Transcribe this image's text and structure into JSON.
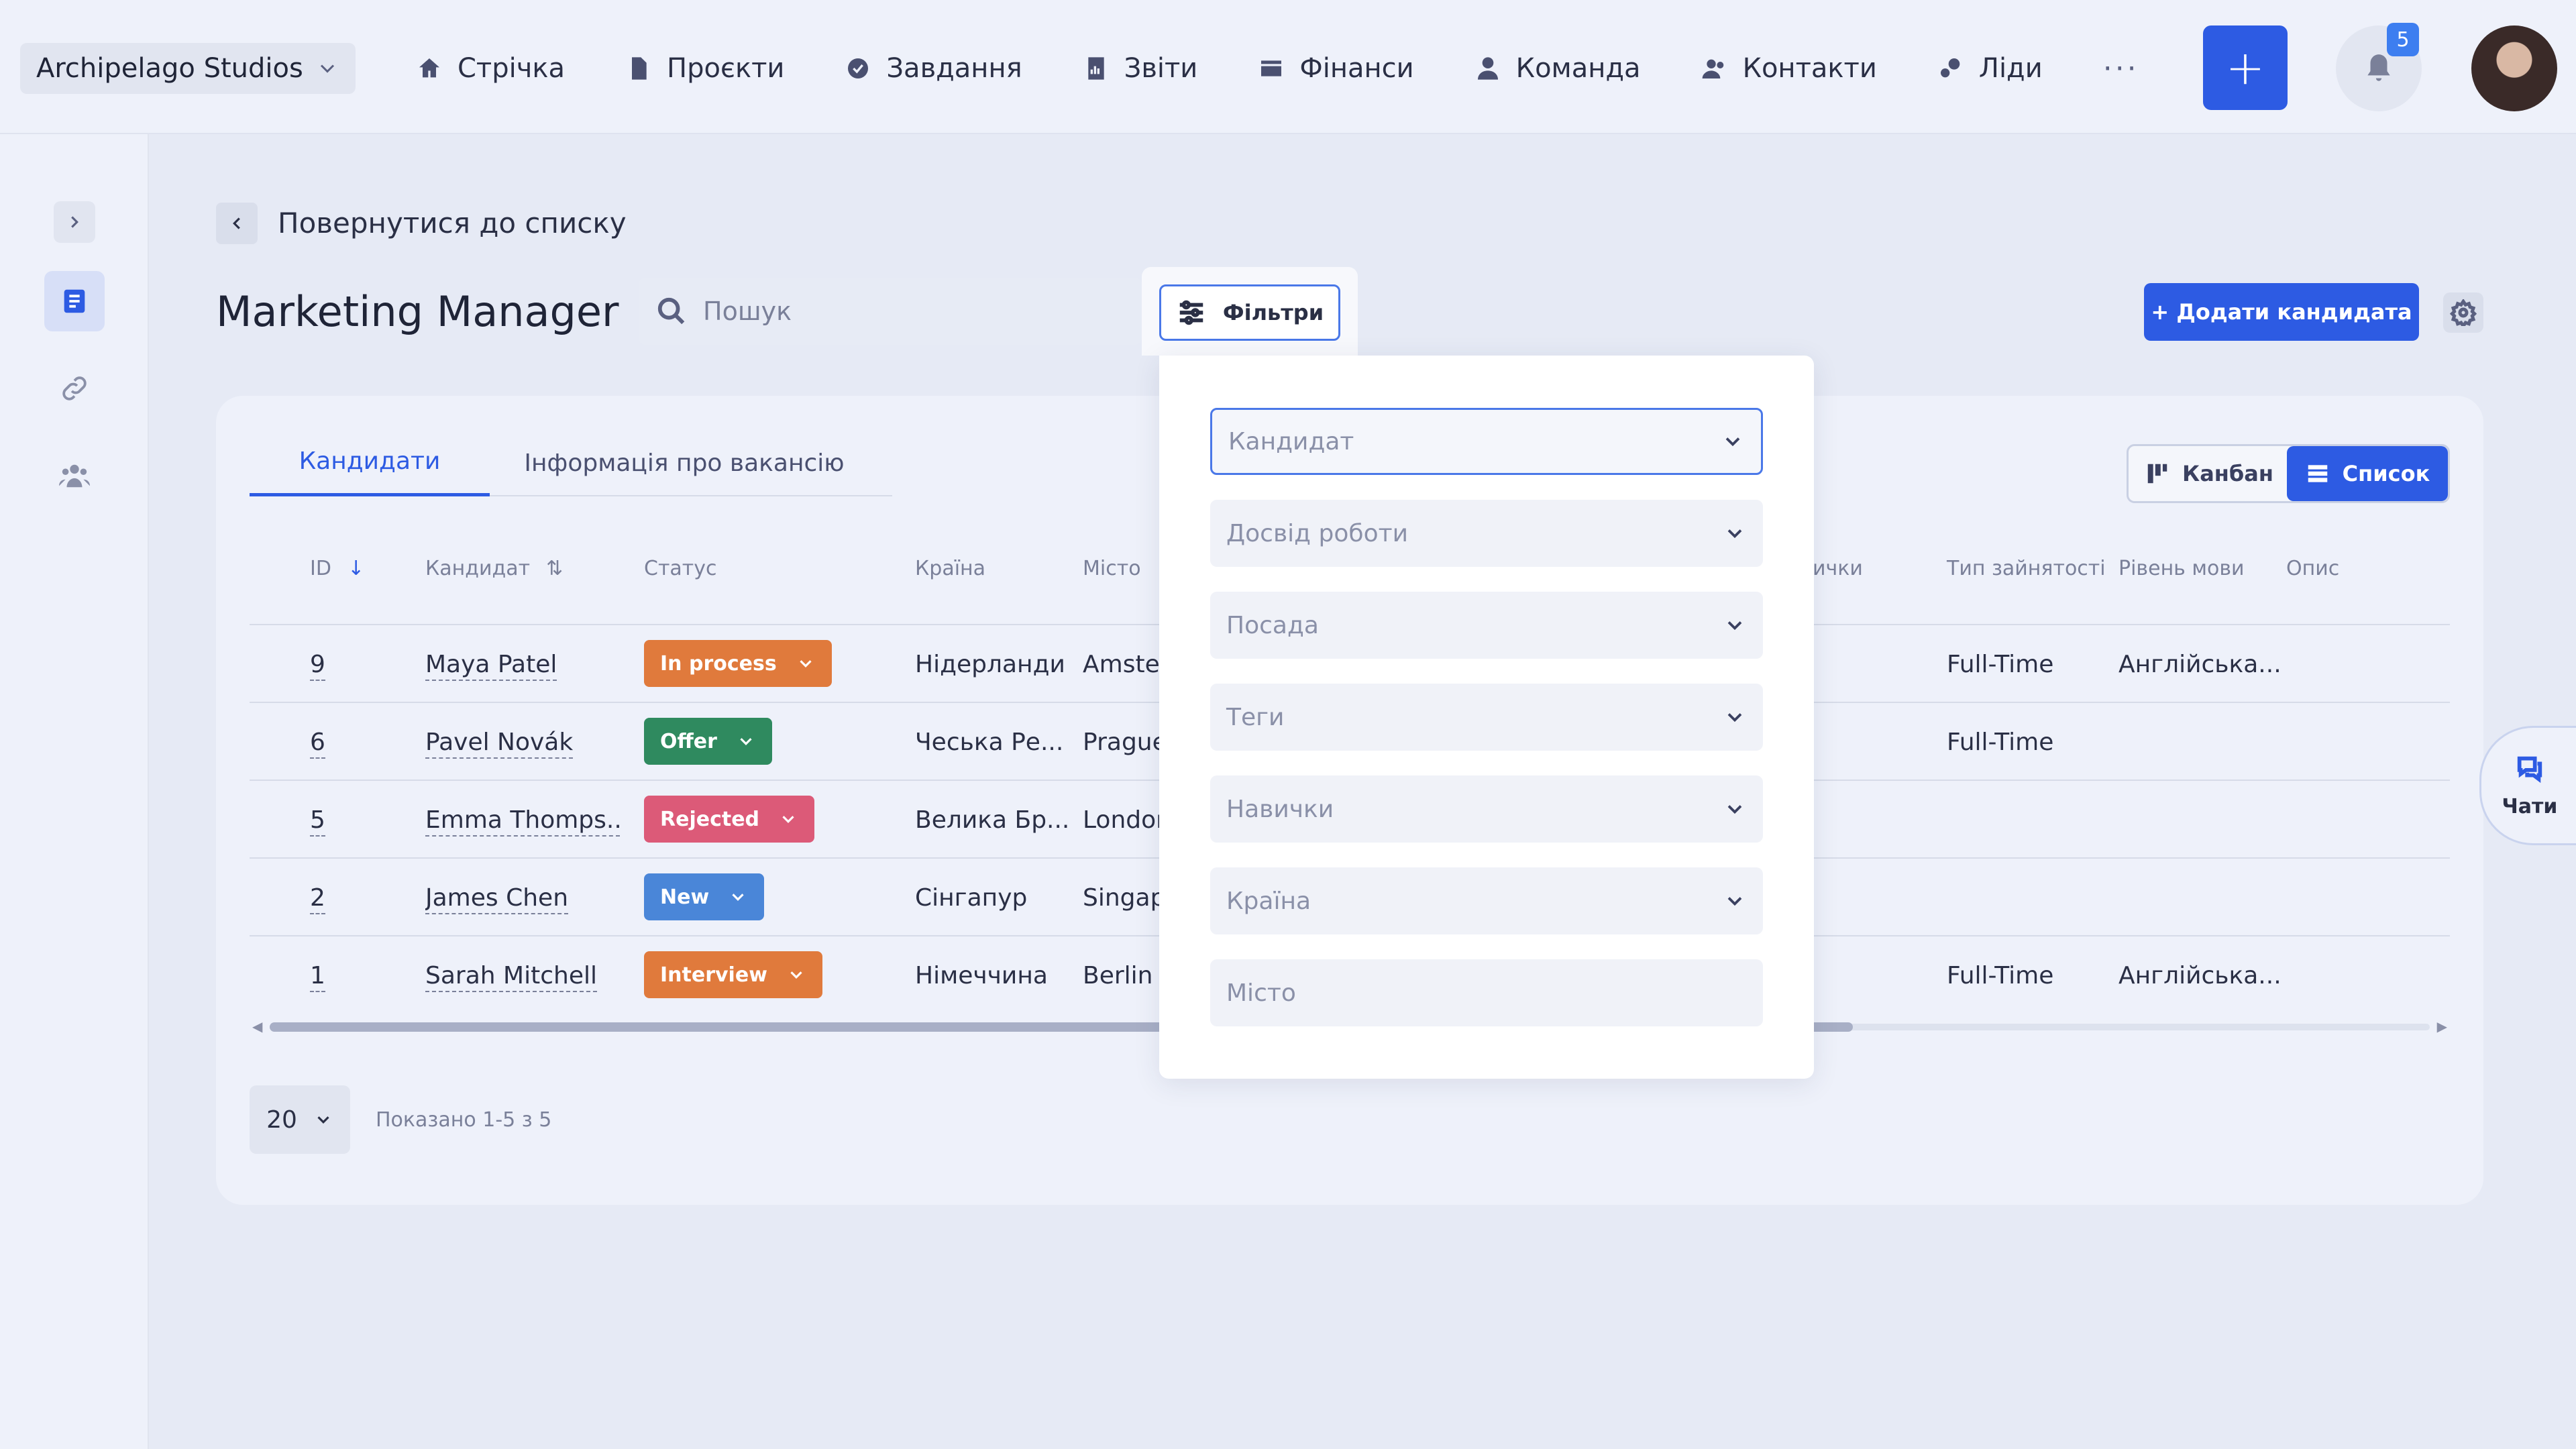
{
  "topbar": {
    "workspace": "Archipelago Studios",
    "nav": [
      {
        "label": "Стрічка",
        "icon": "home-icon"
      },
      {
        "label": "Проєкти",
        "icon": "document-icon"
      },
      {
        "label": "Завдання",
        "icon": "check-circle-icon"
      },
      {
        "label": "Звіти",
        "icon": "report-icon"
      },
      {
        "label": "Фінанси",
        "icon": "wallet-icon"
      },
      {
        "label": "Команда",
        "icon": "user-icon"
      },
      {
        "label": "Контакти",
        "icon": "contacts-icon"
      },
      {
        "label": "Ліди",
        "icon": "leads-icon"
      }
    ],
    "more": "···",
    "add": "+",
    "notifications_count": "5"
  },
  "content": {
    "back_label": "Повернутися до списку",
    "title": "Marketing Manager",
    "search_placeholder": "Пошук",
    "filters_label": "Фільтри",
    "add_candidate_label": "+ Додати кандидата"
  },
  "tabs": [
    {
      "label": "Кандидати",
      "active": true
    },
    {
      "label": "Інформація про вакансію",
      "active": false
    }
  ],
  "view_toggle": {
    "kanban": "Канбан",
    "list": "Список"
  },
  "table": {
    "headers": {
      "id": "ID",
      "candidate": "Кандидат",
      "status": "Статус",
      "country": "Країна",
      "city": "Місто",
      "skills": "ички",
      "employment": "Тип зайнятості",
      "language": "Рівень мови",
      "description": "Опис"
    },
    "rows": [
      {
        "id": "9",
        "name": "Maya Patel",
        "status": "In process",
        "status_color": "#e07a3c",
        "country": "Нідерланди",
        "city": "Amster",
        "employment": "Full-Time",
        "language": "Англійська..."
      },
      {
        "id": "6",
        "name": "Pavel Novák",
        "status": "Offer",
        "status_color": "#2f8a5f",
        "country": "Чеська Ре...",
        "city": "Prague",
        "employment": "Full-Time",
        "language": ""
      },
      {
        "id": "5",
        "name": "Emma Thomps...",
        "status": "Rejected",
        "status_color": "#dc5a78",
        "country": "Велика Бр...",
        "city": "Londor",
        "employment": "",
        "language": ""
      },
      {
        "id": "2",
        "name": "James Chen",
        "status": "New",
        "status_color": "#4a86d8",
        "country": "Сінгапур",
        "city": "Singap",
        "employment": "",
        "language": ""
      },
      {
        "id": "1",
        "name": "Sarah Mitchell",
        "status": "Interview",
        "status_color": "#e07a3c",
        "country": "Німеччина",
        "city": "Berlin",
        "employment": "Full-Time",
        "language": "Англійська..."
      }
    ]
  },
  "pagination": {
    "page_size": "20",
    "shown": "Показано 1-5 з 5"
  },
  "filters_panel": {
    "fields": [
      {
        "placeholder": "Кандидат",
        "focused": true,
        "dropdown": true
      },
      {
        "placeholder": "Досвід роботи",
        "focused": false,
        "dropdown": true
      },
      {
        "placeholder": "Посада",
        "focused": false,
        "dropdown": true
      },
      {
        "placeholder": "Теги",
        "focused": false,
        "dropdown": true
      },
      {
        "placeholder": "Навички",
        "focused": false,
        "dropdown": true
      },
      {
        "placeholder": "Країна",
        "focused": false,
        "dropdown": true
      },
      {
        "placeholder": "Місто",
        "focused": false,
        "dropdown": false
      }
    ]
  },
  "chats_label": "Чати",
  "colors": {
    "accent": "#2d5be3",
    "background": "#e6eaf5"
  }
}
